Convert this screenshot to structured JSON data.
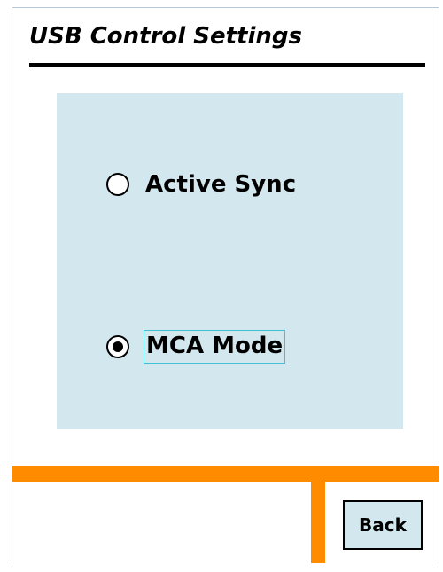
{
  "title": "USB Control Settings",
  "options": [
    {
      "label": "Active Sync",
      "selected": false
    },
    {
      "label": "MCA Mode",
      "selected": true
    }
  ],
  "footer": {
    "back_label": "Back"
  },
  "colors": {
    "panel": "#d2e7ee",
    "accent_bar": "#ff8c00",
    "focus_outline": "#3ec2d6"
  }
}
